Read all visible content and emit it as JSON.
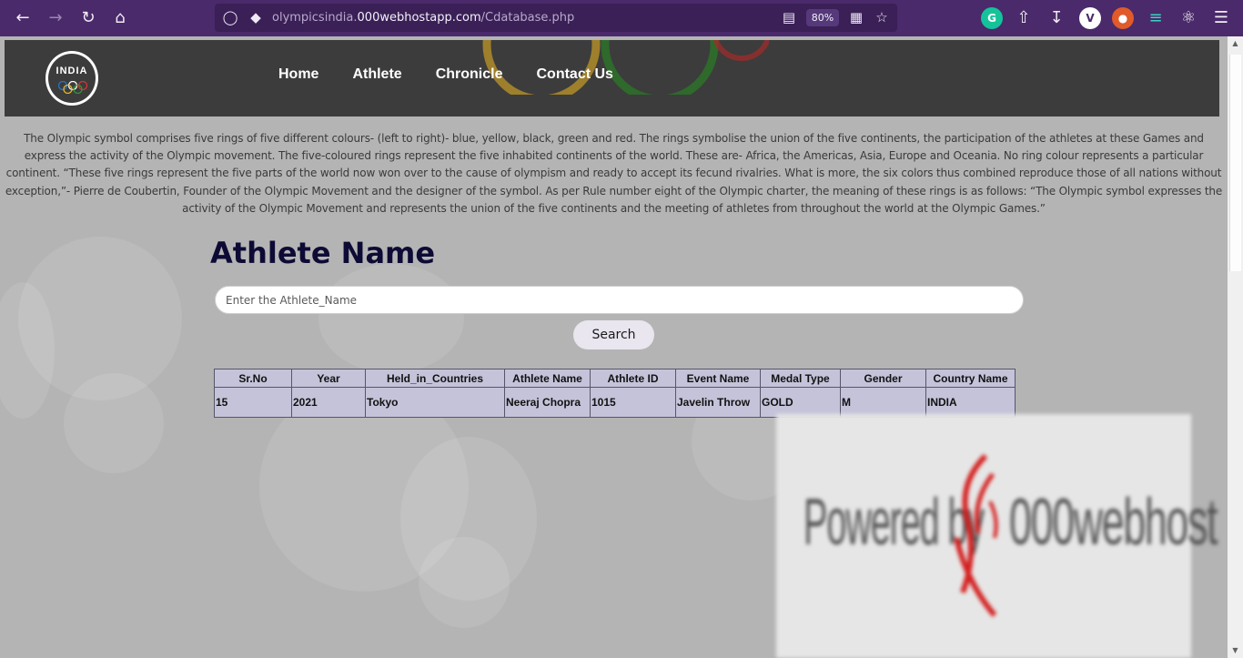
{
  "browser": {
    "url_prefix": "olympicsindia.",
    "url_domain": "000webhostapp.com",
    "url_path": "/Cdatabase.php",
    "zoom": "80%",
    "extensions": [
      {
        "name": "grammarly-icon",
        "glyph": "G",
        "color": "#15c39a"
      },
      {
        "name": "vpn-icon",
        "glyph": "V",
        "color": "#ffffff"
      }
    ]
  },
  "site": {
    "logo_text": "INDIA",
    "nav": [
      "Home",
      "Athlete",
      "Chronicle",
      "Contact Us"
    ],
    "intro": "The Olympic symbol comprises five rings of five different colours- (left to right)- blue, yellow, black, green and red. The rings symbolise the union of the five continents, the participation of the athletes at these Games and express the activity of the Olympic movement. The five-coloured rings represent the five inhabited continents of the world. These are- Africa, the Americas, Asia, Europe and Oceania. No ring colour represents a particular continent. “These five rings represent the five parts of the world now won over to the cause of olympism and ready to accept its fecund rivalries. What is more, the six colors thus combined reproduce those of all nations without exception,”- Pierre de Coubertin, Founder of the Olympic Movement and the designer of the symbol. As per Rule number eight of the Olympic charter, the meaning of these rings is as follows: “The Olympic symbol expresses the activity of the Olympic Movement and represents the union of the five continents and the meeting of athletes from throughout the world at the Olympic Games.”",
    "section_title": "Athlete Name",
    "search_placeholder": "Enter the Athlete_Name",
    "search_button": "Search"
  },
  "table": {
    "columns": [
      "Sr.No",
      "Year",
      "Held_in_Countries",
      "Athlete Name",
      "Athlete ID",
      "Event Name",
      "Medal Type",
      "Gender",
      "Country Name"
    ],
    "rows": [
      [
        "15",
        "2021",
        "Tokyo",
        "Neeraj Chopra",
        "1015",
        "Javelin Throw",
        "GOLD",
        "M",
        "INDIA"
      ]
    ]
  },
  "banner": {
    "text_left": "Powered by",
    "text_right": "000webhost"
  },
  "colors": {
    "browser_bar": "#4a2a6a",
    "header": "#3c3c3c",
    "page_bg": "#b4b4b4",
    "table_bg": "#c4c3d9",
    "title": "#0d0b35"
  }
}
